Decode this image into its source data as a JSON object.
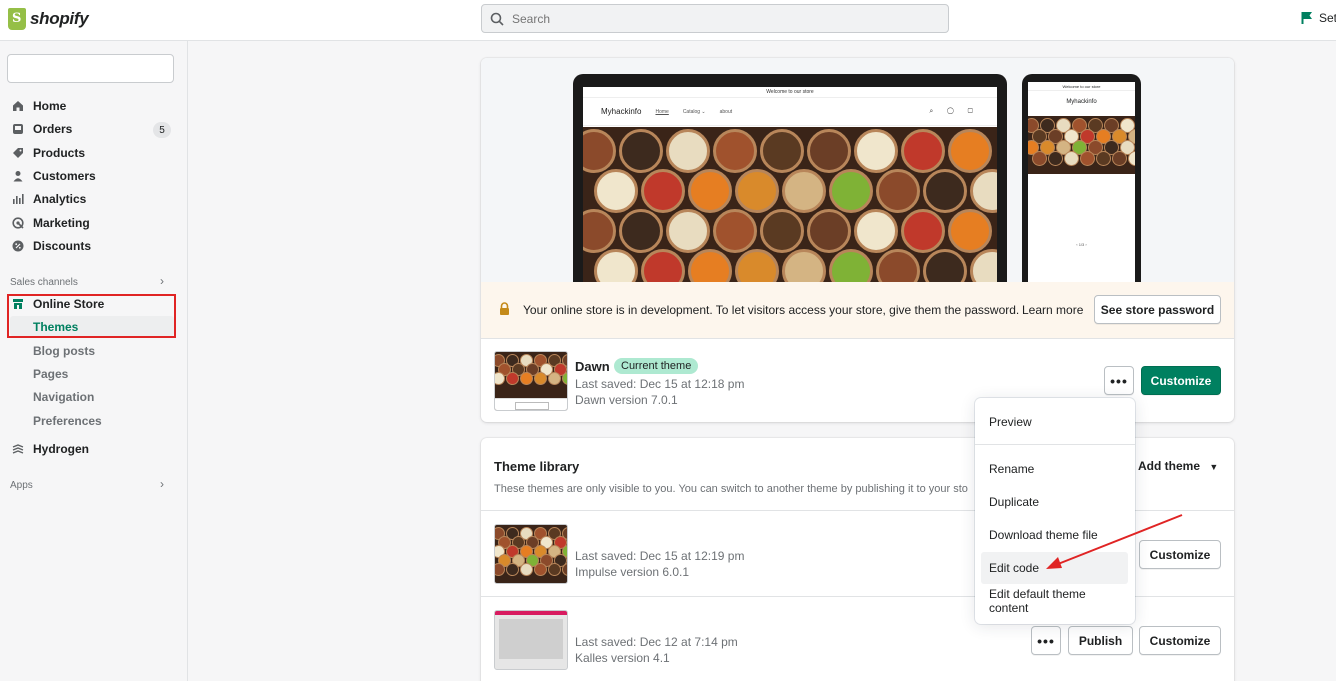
{
  "topbar": {
    "logo_text": "shopify",
    "search_placeholder": "Search",
    "setup_label": "Set"
  },
  "sidebar": {
    "items": [
      {
        "label": "Home",
        "icon": "home-icon"
      },
      {
        "label": "Orders",
        "icon": "orders-icon",
        "badge": "5"
      },
      {
        "label": "Products",
        "icon": "tag-icon"
      },
      {
        "label": "Customers",
        "icon": "person-icon"
      },
      {
        "label": "Analytics",
        "icon": "bar-chart-icon"
      },
      {
        "label": "Marketing",
        "icon": "target-icon"
      },
      {
        "label": "Discounts",
        "icon": "discount-icon"
      }
    ],
    "sales_channels_label": "Sales channels",
    "online_store_label": "Online Store",
    "sub_items": [
      "Themes",
      "Blog posts",
      "Pages",
      "Navigation",
      "Preferences"
    ],
    "hydrogen_label": "Hydrogen",
    "apps_label": "Apps"
  },
  "preview": {
    "laptop_announcement": "Welcome to our store",
    "store_name": "Myhackinfo",
    "store_nav": [
      "Home",
      "Catalog ⌄",
      "about"
    ],
    "phone_announcement": "Welcome to our store",
    "phone_pagination": "‹  1/3  ›"
  },
  "dev_banner": {
    "message": "Your online store is in development. To let visitors access your store, give them the password.",
    "learn_more": "Learn more",
    "password_button": "See store password"
  },
  "current_theme": {
    "name": "Dawn",
    "badge": "Current theme",
    "last_saved": "Last saved: Dec 15 at 12:18 pm",
    "version": "Dawn version 7.0.1",
    "more_button": "•••",
    "customize_button": "Customize"
  },
  "dropdown": {
    "items": [
      "Preview",
      "Rename",
      "Duplicate",
      "Download theme file",
      "Edit code",
      "Edit default theme content"
    ]
  },
  "library": {
    "title": "Theme library",
    "subtitle": "These themes are only visible to you. You can switch to another theme by publishing it to your sto",
    "add_theme": "Add theme",
    "themes": [
      {
        "last_saved": "Last saved: Dec 15 at 12:19 pm",
        "version": "Impulse version 6.0.1",
        "customize": "Customize"
      },
      {
        "last_saved": "Last saved: Dec 12 at 7:14 pm",
        "version": "Kalles version 4.1",
        "more": "•••",
        "publish": "Publish",
        "customize": "Customize"
      }
    ]
  },
  "colors": {
    "primary_green": "#008060",
    "annotation_red": "#e02424",
    "badge_green": "#aee9d1"
  }
}
